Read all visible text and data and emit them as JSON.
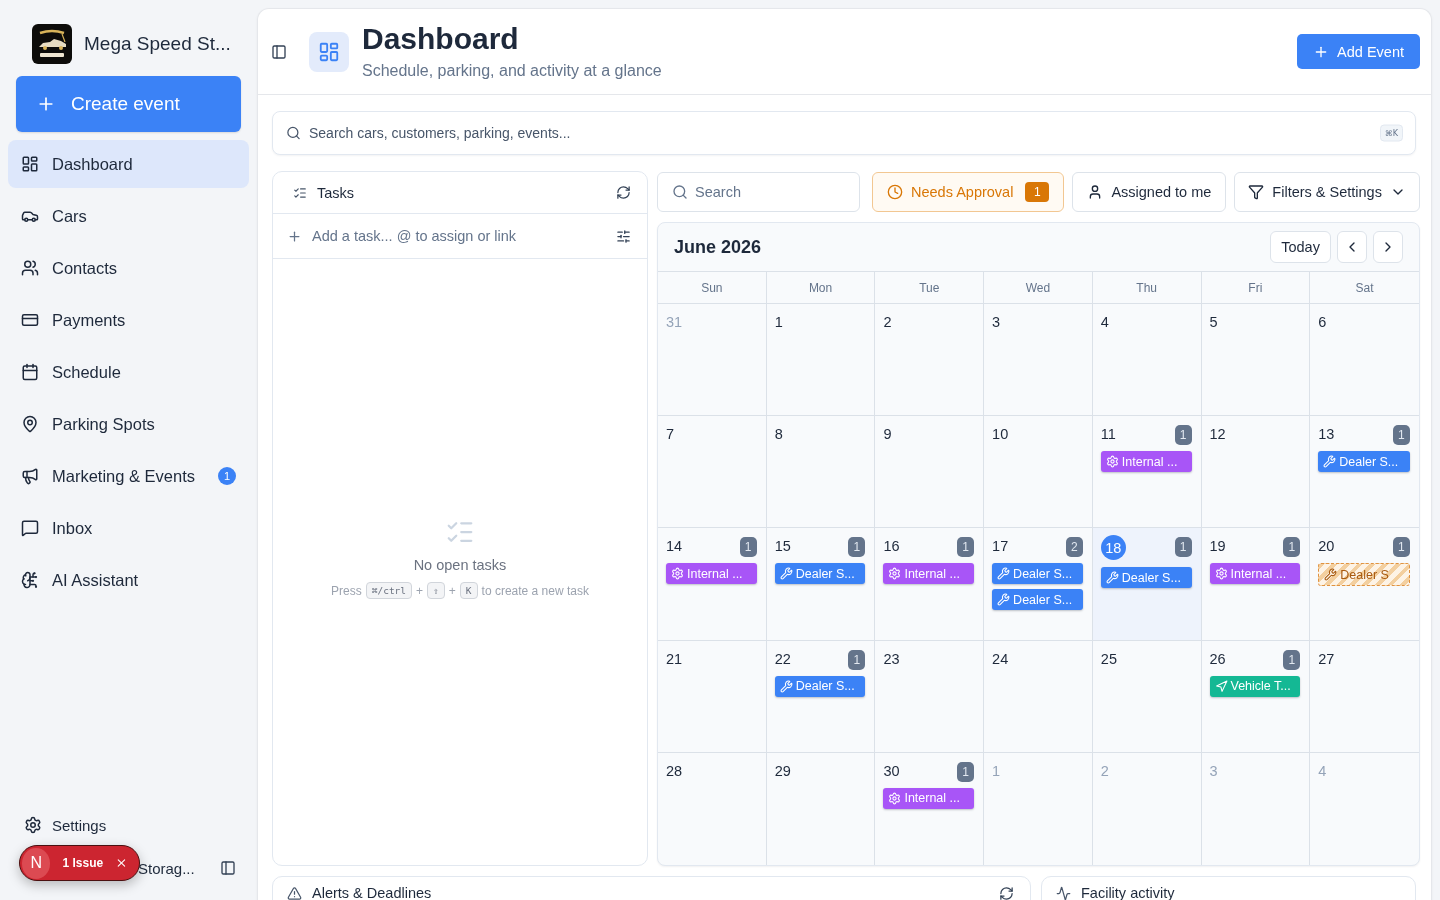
{
  "sidebar": {
    "brand": {
      "name": "Mega Speed St..."
    },
    "create_button": "Create event",
    "nav": [
      {
        "label": "Dashboard",
        "selected": true
      },
      {
        "label": "Cars",
        "selected": false
      },
      {
        "label": "Contacts",
        "selected": false
      },
      {
        "label": "Payments",
        "selected": false
      },
      {
        "label": "Schedule",
        "selected": false
      },
      {
        "label": "Parking Spots",
        "selected": false
      },
      {
        "label": "Marketing & Events",
        "selected": false,
        "badge": "1"
      },
      {
        "label": "Inbox",
        "selected": false
      },
      {
        "label": "AI Assistant",
        "selected": false
      }
    ],
    "settings": "Settings",
    "user": {
      "name": "Storag..."
    }
  },
  "issue_overlay": {
    "avatar": "N",
    "label": "1 Issue"
  },
  "header": {
    "title": "Dashboard",
    "subtitle": "Schedule, parking, and activity at a glance",
    "add_button": "Add Event"
  },
  "global_search": {
    "placeholder": "Search cars, customers, parking, events...",
    "shortcut": "⌘K"
  },
  "tasks": {
    "title": "Tasks",
    "add_placeholder": "Add a task... @ to assign or link",
    "empty_title": "No open tasks",
    "empty_hint": [
      {
        "kind": "text",
        "text": "Press"
      },
      {
        "kind": "key",
        "text": "⌘/ctrl"
      },
      {
        "kind": "text",
        "text": "+"
      },
      {
        "kind": "key",
        "text": "⇧"
      },
      {
        "kind": "text",
        "text": "+"
      },
      {
        "kind": "key",
        "text": "K"
      },
      {
        "kind": "text",
        "text": "to create a new task"
      }
    ]
  },
  "calendar_toolbar": {
    "search_placeholder": "Search",
    "buttons": [
      {
        "kind": "approval",
        "label": "Needs Approval",
        "badge": "1"
      },
      {
        "kind": "assigned",
        "label": "Assigned to me"
      },
      {
        "kind": "filters",
        "label": "Filters & Settings"
      }
    ]
  },
  "calendar": {
    "month": "June 2026",
    "today_button": "Today",
    "weekdays": [
      "Sun",
      "Mon",
      "Tue",
      "Wed",
      "Thu",
      "Fri",
      "Sat"
    ],
    "weeks": [
      {
        "days": [
          {
            "date": "31",
            "outside": true,
            "today": false
          },
          {
            "date": "1",
            "outside": false,
            "today": false
          },
          {
            "date": "2",
            "outside": false,
            "today": false
          },
          {
            "date": "3",
            "outside": false,
            "today": false
          },
          {
            "date": "4",
            "outside": false,
            "today": false
          },
          {
            "date": "5",
            "outside": false,
            "today": false
          },
          {
            "date": "6",
            "outside": false,
            "today": false
          }
        ]
      },
      {
        "days": [
          {
            "date": "7",
            "outside": false,
            "today": false
          },
          {
            "date": "8",
            "outside": false,
            "today": false
          },
          {
            "date": "9",
            "outside": false,
            "today": false
          },
          {
            "date": "10",
            "outside": false,
            "today": false
          },
          {
            "date": "11",
            "outside": false,
            "today": false,
            "count": "1",
            "events": [
              {
                "kind": "internal",
                "label": "Internal ...",
                "color": "#a855f7",
                "pending": false
              }
            ]
          },
          {
            "date": "12",
            "outside": false,
            "today": false
          },
          {
            "date": "13",
            "outside": false,
            "today": false,
            "count": "1",
            "events": [
              {
                "kind": "dealer",
                "label": "Dealer S...",
                "color": "#3b82f6",
                "pending": false
              }
            ]
          }
        ]
      },
      {
        "days": [
          {
            "date": "14",
            "outside": false,
            "today": false,
            "count": "1",
            "events": [
              {
                "kind": "internal",
                "label": "Internal ...",
                "color": "#a855f7",
                "pending": false
              }
            ]
          },
          {
            "date": "15",
            "outside": false,
            "today": false,
            "count": "1",
            "events": [
              {
                "kind": "dealer",
                "label": "Dealer S...",
                "color": "#3b82f6",
                "pending": false
              }
            ]
          },
          {
            "date": "16",
            "outside": false,
            "today": false,
            "count": "1",
            "events": [
              {
                "kind": "internal",
                "label": "Internal ...",
                "color": "#a855f7",
                "pending": false
              }
            ]
          },
          {
            "date": "17",
            "outside": false,
            "today": false,
            "count": "2",
            "events": [
              {
                "kind": "dealer",
                "label": "Dealer S...",
                "color": "#3b82f6",
                "pending": false
              },
              {
                "kind": "dealer",
                "label": "Dealer S...",
                "color": "#3b82f6",
                "pending": false
              }
            ]
          },
          {
            "date": "18",
            "outside": false,
            "today": true,
            "count": "1",
            "events": [
              {
                "kind": "dealer",
                "label": "Dealer S...",
                "color": "#3b82f6",
                "pending": false
              }
            ]
          },
          {
            "date": "19",
            "outside": false,
            "today": false,
            "count": "1",
            "events": [
              {
                "kind": "internal",
                "label": "Internal ...",
                "color": "#a855f7",
                "pending": false
              }
            ]
          },
          {
            "date": "20",
            "outside": false,
            "today": false,
            "count": "1",
            "events": [
              {
                "kind": "dealer",
                "label": "Dealer S",
                "color": "#e09240",
                "pending": true
              }
            ]
          }
        ]
      },
      {
        "days": [
          {
            "date": "21",
            "outside": false,
            "today": false
          },
          {
            "date": "22",
            "outside": false,
            "today": false,
            "count": "1",
            "events": [
              {
                "kind": "dealer",
                "label": "Dealer S...",
                "color": "#3b82f6",
                "pending": false
              }
            ]
          },
          {
            "date": "23",
            "outside": false,
            "today": false
          },
          {
            "date": "24",
            "outside": false,
            "today": false
          },
          {
            "date": "25",
            "outside": false,
            "today": false
          },
          {
            "date": "26",
            "outside": false,
            "today": false,
            "count": "1",
            "events": [
              {
                "kind": "vehicle",
                "label": "Vehicle T...",
                "color": "#14b894",
                "pending": false
              }
            ]
          },
          {
            "date": "27",
            "outside": false,
            "today": false
          }
        ]
      },
      {
        "days": [
          {
            "date": "28",
            "outside": false,
            "today": false
          },
          {
            "date": "29",
            "outside": false,
            "today": false
          },
          {
            "date": "30",
            "outside": false,
            "today": false,
            "count": "1",
            "events": [
              {
                "kind": "internal",
                "label": "Internal ...",
                "color": "#a855f7",
                "pending": false
              }
            ]
          },
          {
            "date": "1",
            "outside": true,
            "today": false
          },
          {
            "date": "2",
            "outside": true,
            "today": false
          },
          {
            "date": "3",
            "outside": true,
            "today": false
          },
          {
            "date": "4",
            "outside": true,
            "today": false
          }
        ]
      }
    ]
  },
  "bottom_panels": [
    {
      "kind": "alerts",
      "title": "Alerts & Deadlines"
    },
    {
      "kind": "activity",
      "title": "Facility activity"
    }
  ]
}
